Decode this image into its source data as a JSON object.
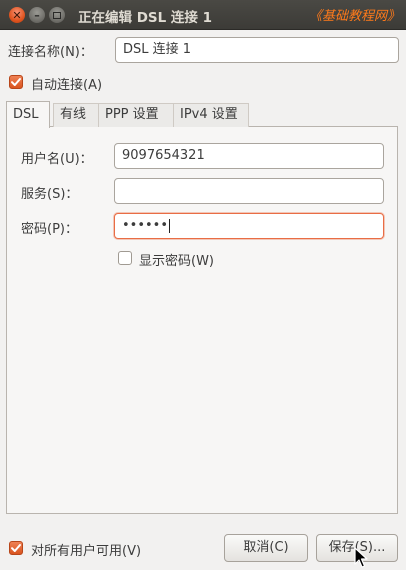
{
  "window": {
    "title": "正在编辑 DSL 连接 1",
    "watermark": "《基础教程网》",
    "close_glyph": "✕",
    "minimize_glyph": "–"
  },
  "connection_name": {
    "label": "连接名称(N)：",
    "value": "DSL 连接 1"
  },
  "auto_connect": {
    "label": "自动连接(A)",
    "checked": true
  },
  "tabs": [
    {
      "label": "DSL",
      "active": true
    },
    {
      "label": "有线",
      "active": false
    },
    {
      "label": "PPP 设置",
      "active": false
    },
    {
      "label": "IPv4 设置",
      "active": false
    }
  ],
  "dsl": {
    "username": {
      "label": "用户名(U)：",
      "value": "9097654321"
    },
    "service": {
      "label": "服务(S)：",
      "value": ""
    },
    "password": {
      "label": "密码(P)：",
      "value": "••••••"
    },
    "show_password": {
      "label": "显示密码(W)",
      "checked": false
    }
  },
  "footer": {
    "all_users": {
      "label": "对所有用户可用(V)",
      "checked": true
    },
    "cancel_label": "取消(C)",
    "save_label": "保存(S)..."
  },
  "colors": {
    "accent": "#e96d45",
    "titlebar": "#3c3b37",
    "watermark": "#ff7a1a"
  }
}
